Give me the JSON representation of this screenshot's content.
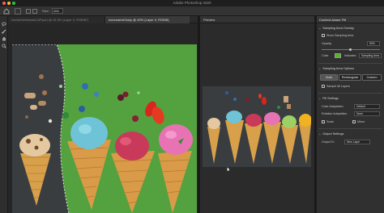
{
  "window": {
    "title": "Adobe Photoshop 2020"
  },
  "options": {
    "size_label": "Size:",
    "size_value": "200"
  },
  "tabs": [
    {
      "label": "DerfarGirlfriendsCAP.psd @ 33.3% (Layer 0, RGB/8*)"
    },
    {
      "label": "IcecreamIsTasty @ 49% (Layer 0, RGB/8)"
    }
  ],
  "preview": {
    "title": "Preview"
  },
  "panel": {
    "title": "Content-Aware Fill",
    "sampling_overlay": "Sampling Area Overlay",
    "show_sampling": "Show Sampling Area",
    "opacity_label": "Opacity",
    "opacity_value": "50%",
    "color_label": "Color",
    "indicates_label": "Indicates",
    "indicates_value": "Sampling Area",
    "sampling_options": "Sampling Area Options",
    "btn_auto": "Auto",
    "btn_rect": "Rectangular",
    "btn_custom": "Custom",
    "sample_all": "Sample All Layers",
    "fill_settings": "Fill Settings",
    "color_adapt_label": "Color Adaptation",
    "color_adapt_value": "Default",
    "rotation_label": "Rotation Adaptation",
    "rotation_value": "None",
    "scale_label": "Scale",
    "mirror_label": "Mirror",
    "output_settings": "Output Settings",
    "output_label": "Output To",
    "output_value": "New Layer"
  },
  "colors": {
    "overlay_color": "#58b32c",
    "background": "#262626",
    "panel": "#303030"
  }
}
